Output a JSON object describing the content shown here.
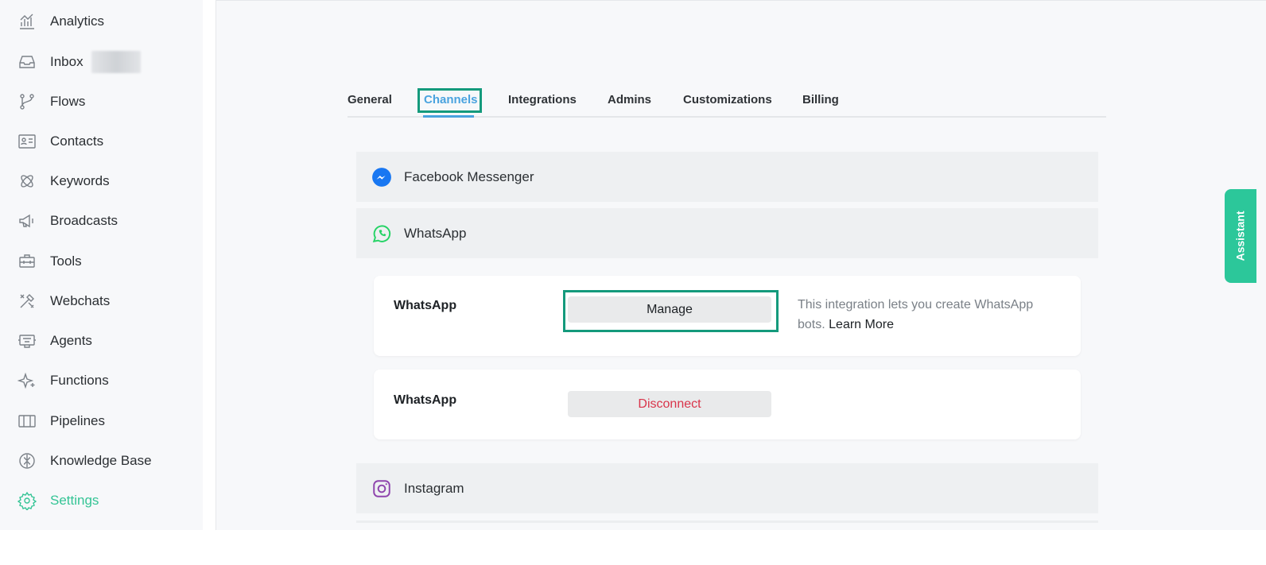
{
  "sidebar": {
    "items": [
      {
        "label": "Analytics",
        "icon": "analytics-icon"
      },
      {
        "label": "Inbox",
        "icon": "inbox-icon"
      },
      {
        "label": "Flows",
        "icon": "flows-icon"
      },
      {
        "label": "Contacts",
        "icon": "contacts-icon"
      },
      {
        "label": "Keywords",
        "icon": "keywords-icon"
      },
      {
        "label": "Broadcasts",
        "icon": "megaphone-icon"
      },
      {
        "label": "Tools",
        "icon": "toolbox-icon"
      },
      {
        "label": "Webchats",
        "icon": "tools-cross-icon"
      },
      {
        "label": "Agents",
        "icon": "agent-icon"
      },
      {
        "label": "Functions",
        "icon": "sparkle-icon"
      },
      {
        "label": "Pipelines",
        "icon": "pipelines-icon"
      },
      {
        "label": "Knowledge Base",
        "icon": "brain-icon"
      },
      {
        "label": "Settings",
        "icon": "gear-icon"
      }
    ],
    "active": "Settings",
    "active_color": "#34c495"
  },
  "tabs": [
    {
      "label": "General"
    },
    {
      "label": "Channels"
    },
    {
      "label": "Integrations"
    },
    {
      "label": "Admins"
    },
    {
      "label": "Customizations"
    },
    {
      "label": "Billing"
    }
  ],
  "active_tab": "Channels",
  "channels": {
    "facebook": {
      "label": "Facebook Messenger",
      "icon": "messenger-icon"
    },
    "whatsapp": {
      "label": "WhatsApp",
      "icon": "whatsapp-icon"
    },
    "instagram": {
      "label": "Instagram",
      "icon": "instagram-icon"
    }
  },
  "whatsapp_cards": [
    {
      "title": "WhatsApp",
      "button_label": "Manage",
      "description": "This integration lets you create WhatsApp bots.",
      "link_label": "Learn More"
    },
    {
      "title": "WhatsApp",
      "button_label": "Disconnect"
    }
  ],
  "assistant": {
    "label": "Assistant",
    "color": "#2cc79a"
  },
  "colors": {
    "highlight_border": "#149a7c",
    "tab_active": "#4aa3df",
    "disconnect": "#d9344a",
    "messenger": "#1877f2",
    "whatsapp": "#25d366",
    "instagram": "#8e44ad"
  }
}
